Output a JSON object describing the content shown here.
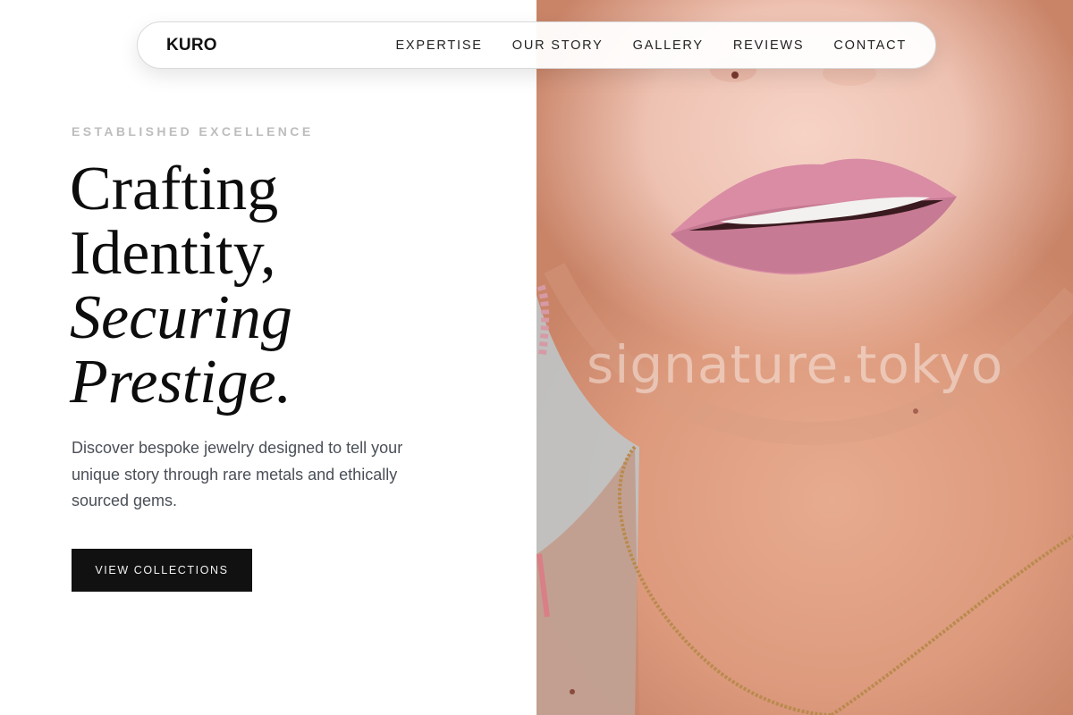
{
  "nav": {
    "logo": "KURO",
    "links": [
      "EXPERTISE",
      "OUR STORY",
      "GALLERY",
      "REVIEWS",
      "CONTACT"
    ]
  },
  "hero": {
    "eyebrow": "ESTABLISHED EXCELLENCE",
    "headline": [
      "Crafting",
      "Identity,",
      "Securing",
      "Prestige."
    ],
    "subtext": "Discover bespoke jewelry designed to tell your unique story through rare metals and ethically sourced gems.",
    "cta_label": "VIEW COLLECTIONS"
  },
  "photo": {
    "watermark": "signature.tokyo",
    "subject": "close-up of a woman's smiling lips, chin and neck wearing a fine gold chain necklace"
  },
  "colors": {
    "accent": "#111111",
    "eyebrow": "#bdbdbd",
    "body_text": "#4a4f57",
    "background": "#ffffff"
  }
}
